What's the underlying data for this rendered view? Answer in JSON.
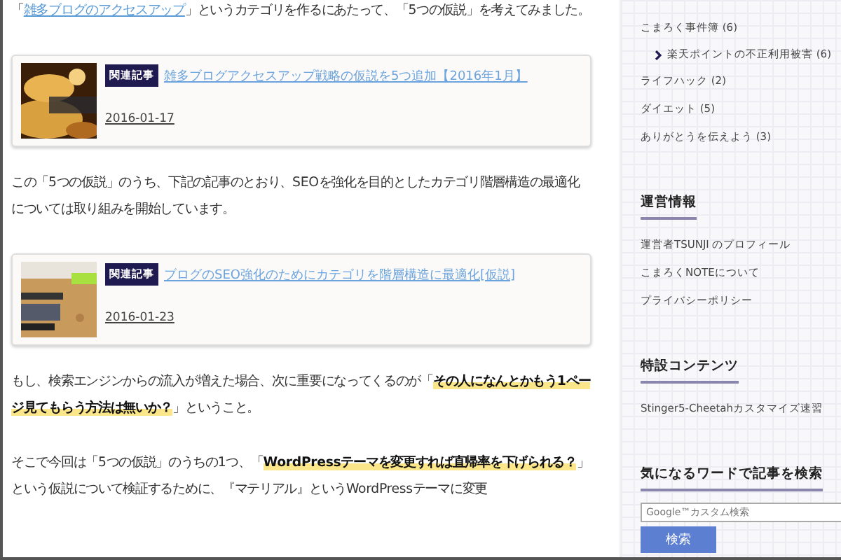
{
  "article": {
    "blocks": [
      {
        "kind": "paragraph",
        "segments": [
          {
            "kind": "plain",
            "text": "「"
          },
          {
            "kind": "link",
            "text": "雑多ブログのアクセスアップ"
          },
          {
            "kind": "plain",
            "text": "」というカテゴリを作るにあたって、「5つの仮説」を考えてみました。"
          }
        ]
      },
      {
        "kind": "card",
        "badge": "関連記事",
        "title": "雑多ブログアクセスアップ戦略の仮説を5つ追加【2016年1月】",
        "date": "2016-01-17"
      },
      {
        "kind": "paragraph",
        "segments": [
          {
            "kind": "plain",
            "text": "この「5つの仮説」のうち、下記の記事のとおり、SEOを強化を目的としたカテゴリ階層構造の最適化については取り組みを開始しています。"
          }
        ]
      },
      {
        "kind": "card",
        "badge": "関連記事",
        "title": "ブログのSEO強化のためにカテゴリを階層構造に最適化[仮説]",
        "date": "2016-01-23"
      },
      {
        "kind": "paragraph",
        "segments": [
          {
            "kind": "plain",
            "text": "もし、検索エンジンからの流入が増えた場合、次に重要になってくるのが「"
          },
          {
            "kind": "marker",
            "text": "その人になんとかもう1ページ見てもらう方法は無いか？"
          },
          {
            "kind": "plain",
            "text": "」ということ。"
          }
        ]
      },
      {
        "kind": "paragraph",
        "segments": [
          {
            "kind": "plain",
            "text": "そこで今回は「5つの仮説」のうちの1つ、「"
          },
          {
            "kind": "marker",
            "text": "WordPressテーマを変更すれば直帰率を下げられる？"
          },
          {
            "kind": "plain",
            "text": "」という仮説について検証するために、『マテリアル』というWordPressテーマに変更"
          }
        ]
      }
    ]
  },
  "sidebar": {
    "sections": [
      {
        "items": [
          {
            "label": "こまろく事件簿 (6)",
            "children": [
              {
                "label": "楽天ポイントの不正利用被害 (6)"
              }
            ]
          },
          {
            "label": "ライフハック (2)"
          },
          {
            "label": "ダイエット (5)"
          },
          {
            "label": "ありがとうを伝えよう (3)"
          }
        ]
      },
      {
        "heading": "運営情報",
        "items": [
          {
            "label": "運営者TSUNJI のプロフィール"
          },
          {
            "label": "こまろくNOTEについて"
          },
          {
            "label": "プライバシーポリシー"
          }
        ]
      },
      {
        "heading": "特設コンテンツ",
        "items": [
          {
            "label": "Stinger5-Cheetahカスタマイズ速習"
          }
        ]
      },
      {
        "heading": "気になるワードで記事を検索",
        "search": {
          "placeholder": "Google™カスタム検索",
          "button": "検索"
        }
      }
    ]
  }
}
